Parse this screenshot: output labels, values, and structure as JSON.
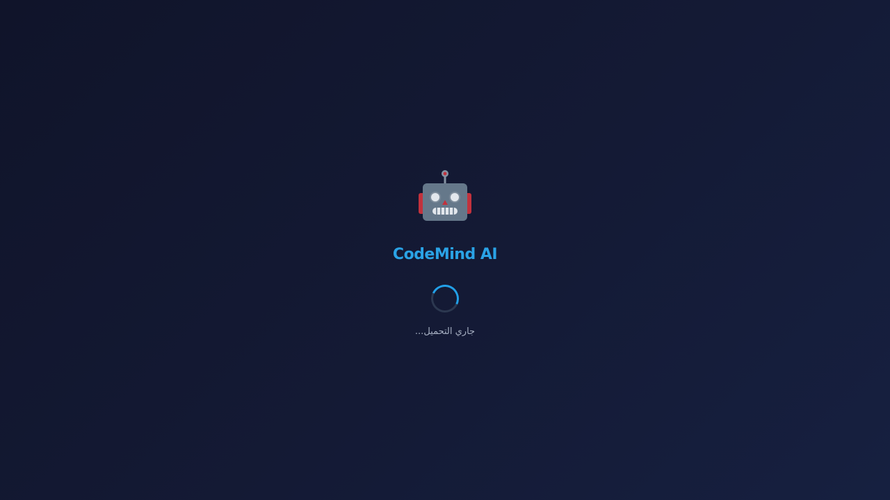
{
  "app": {
    "icon": "robot-icon",
    "title": "CodeMind AI"
  },
  "loader": {
    "text": "جاري التحميل..."
  },
  "colors": {
    "background": "#131935",
    "title": "#2aa3e6",
    "spinner_accent": "#22a0e8",
    "spinner_track": "#2c3850",
    "loading_text": "#a6afc2"
  }
}
